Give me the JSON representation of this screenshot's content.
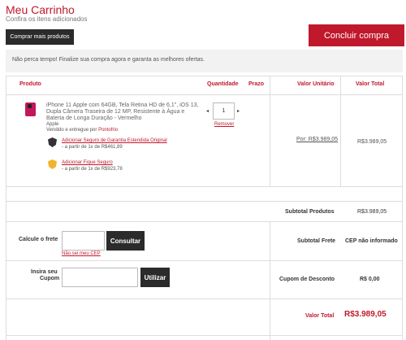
{
  "header": {
    "title": "Meu Carrinho",
    "subtitle": "Confira os itens adicionados",
    "more_products_label": "Comprar mais produtos",
    "checkout_label": "Concluir compra"
  },
  "notice": "Não perca tempo! Finalize sua compra agora e garanta as melhores ofertas.",
  "table": {
    "columns": [
      "Produto",
      "Quantidade",
      "Prazo",
      "Valor Unitário",
      "Valor Total"
    ]
  },
  "item": {
    "name": "iPhone 11 Apple com 64GB, Tela Retina HD de 6,1\", iOS 13, Dupla Câmera Traseira de 12 MP, Resistente à Água e Bateria de Longa Duração - Vermelho",
    "brand": "Apple",
    "seller_prefix": "Vendido e entregue por",
    "seller": "Pontofrio",
    "insurance_1": {
      "link": "Adicionar Seguro de Garantia Estendida Original",
      "sub": "- a partir de 1x de R$461,89"
    },
    "insurance_2": {
      "link": "Adicionar Fique Seguro",
      "sub": "- a partir de 1x de R$923,78"
    },
    "quantity": "1",
    "remove_label": "Remover",
    "unit_price": "Por: R$3.989,05",
    "total_price": "R$3.989,05"
  },
  "summary": {
    "subtotal_products_label": "Subtotal Produtos",
    "subtotal_products_value": "R$3.989,05",
    "freight_prompt": "Calcule o frete",
    "freight_button": "Consultar",
    "cep_unknown_link": "Não sei meu CEP",
    "subtotal_freight_label": "Subtotal Frete",
    "subtotal_freight_value": "CEP não informado",
    "coupon_prompt_1": "Insira seu",
    "coupon_prompt_2": "Cupom",
    "coupon_button": "Utilizar",
    "discount_label": "Cupom de Desconto",
    "discount_value": "R$ 0,00",
    "total_label": "Valor Total",
    "total_value": "R$3.989,05"
  },
  "colors": {
    "accent": "#c0192c",
    "dark_button": "#2b2b2b",
    "notice_bg": "#f2f2f2",
    "badge_gold": "#f1b52a"
  },
  "icons": [
    "insurance-shield-dark-icon",
    "insurance-shield-gold-icon",
    "arrow-left-icon",
    "arrow-right-icon"
  ]
}
